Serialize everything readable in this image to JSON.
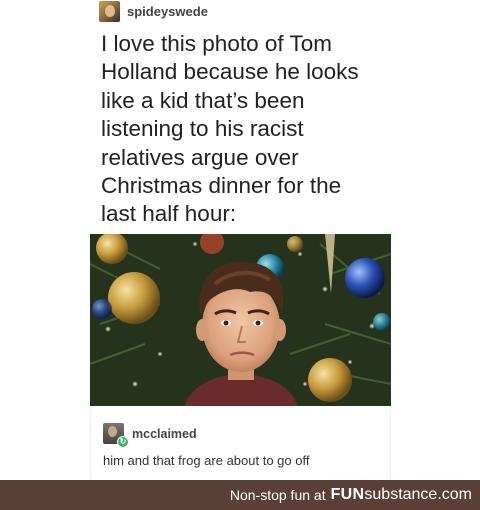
{
  "post": {
    "author": "spideyswede",
    "text": "I love this photo of Tom\nHolland because he looks\nlike a kid that’s been\nlistening to his racist\nrelatives argue over\nChristmas dinner for the\nlast half hour:"
  },
  "reply": {
    "author": "mcclaimed",
    "text": "him and that frog are about to go off",
    "badge_icon": "reblog-icon"
  },
  "footer": {
    "tagline": "Non-stop fun at",
    "logo_fun": "FUN",
    "logo_substance": "substance",
    "logo_domain": ".com"
  },
  "colors": {
    "footer_bg": "#5a4037",
    "reblog_badge": "#3fb36b"
  }
}
